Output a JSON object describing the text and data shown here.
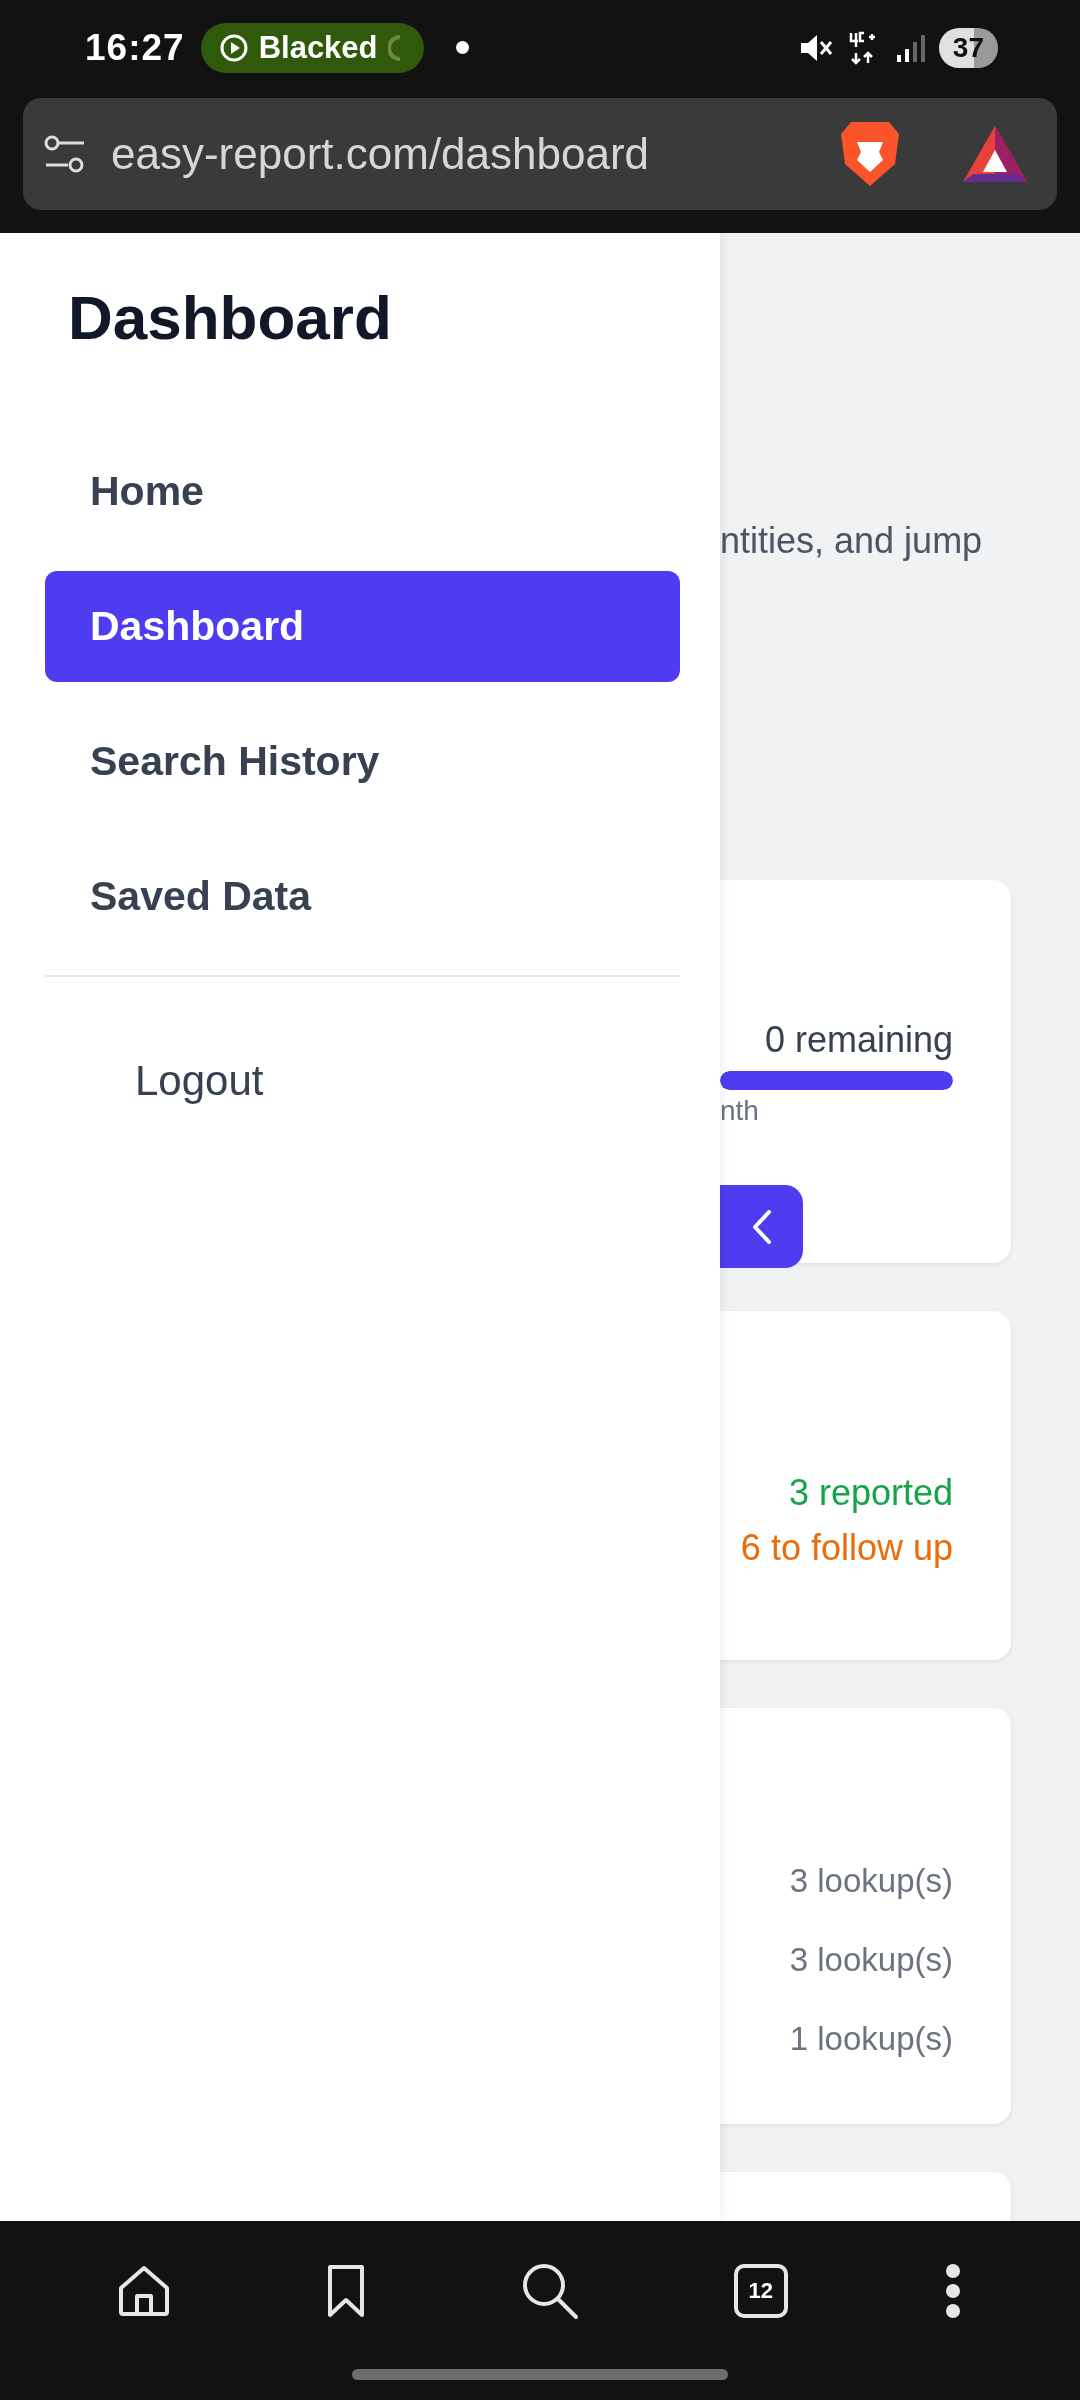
{
  "status_bar": {
    "time": "16:27",
    "media_pill": "Blacked",
    "battery": "37"
  },
  "address_bar": {
    "url": "easy-report.com/dashboard"
  },
  "drawer": {
    "title": "Dashboard",
    "items": [
      {
        "label": "Home",
        "selected": false
      },
      {
        "label": "Dashboard",
        "selected": true
      },
      {
        "label": "Search History",
        "selected": false
      },
      {
        "label": "Saved Data",
        "selected": false
      }
    ],
    "logout": "Logout"
  },
  "page": {
    "intro_fragment": "ntities, and jump",
    "cards": [
      {
        "kind": "quota",
        "reading": "0 remaining",
        "level": 1,
        "note_fragment": "nth"
      },
      {
        "kind": "status",
        "lines": [
          {
            "text": "3 reported",
            "color": "#16a34a"
          },
          {
            "text": "6 to follow up",
            "color": "#ea6c0a"
          }
        ]
      },
      {
        "kind": "lookups",
        "rows": [
          "3 lookup(s)",
          "3 lookup(s)",
          "1 lookup(s)"
        ]
      },
      {
        "kind": "empty"
      }
    ]
  },
  "bottom_nav": {
    "tab_count": "12"
  }
}
